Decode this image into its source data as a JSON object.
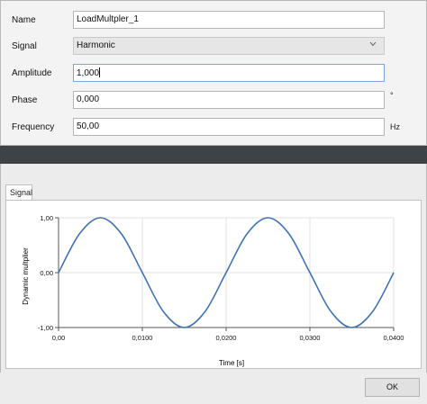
{
  "form": {
    "name_label": "Name",
    "name_value": "LoadMultpler_1",
    "signal_label": "Signal",
    "signal_value": "Harmonic",
    "amplitude_label": "Amplitude",
    "amplitude_value": "1,000",
    "phase_label": "Phase",
    "phase_value": "0,000",
    "phase_unit": "°",
    "frequency_label": "Frequency",
    "frequency_value": "50,00",
    "frequency_unit": "Hz"
  },
  "tab": {
    "signal_label": "Signal"
  },
  "buttons": {
    "ok_label": "OK"
  },
  "colors": {
    "curve": "#3f73b6",
    "divider": "#3e4347",
    "focus_border": "#7aa7d6"
  },
  "icons": {
    "dropdown": "chevron-down-icon"
  },
  "chart_data": {
    "type": "line",
    "xlabel": "Time [s]",
    "ylabel": "Dynamic multplier",
    "xlim": [
      0,
      0.04
    ],
    "ylim": [
      -1,
      1
    ],
    "x_tick_labels": [
      "0,00",
      "0,0100",
      "0,0200",
      "0,0300",
      "0,0400"
    ],
    "x_ticks": [
      0,
      0.01,
      0.02,
      0.03,
      0.04
    ],
    "y_tick_labels": [
      "1,00",
      "0,00",
      "-1,00"
    ],
    "y_ticks": [
      1,
      0,
      -1
    ],
    "grid": true,
    "series": [
      {
        "x": [
          0,
          0.0025,
          0.005,
          0.0075,
          0.01,
          0.0125,
          0.015,
          0.0175,
          0.02,
          0.0225,
          0.025,
          0.0275,
          0.03,
          0.0325,
          0.035,
          0.0375,
          0.04
        ],
        "y": [
          0,
          0.707,
          1,
          0.707,
          0,
          -0.707,
          -1,
          -0.707,
          0,
          0.707,
          1,
          0.707,
          0,
          -0.707,
          -1,
          -0.707,
          0
        ]
      }
    ]
  }
}
